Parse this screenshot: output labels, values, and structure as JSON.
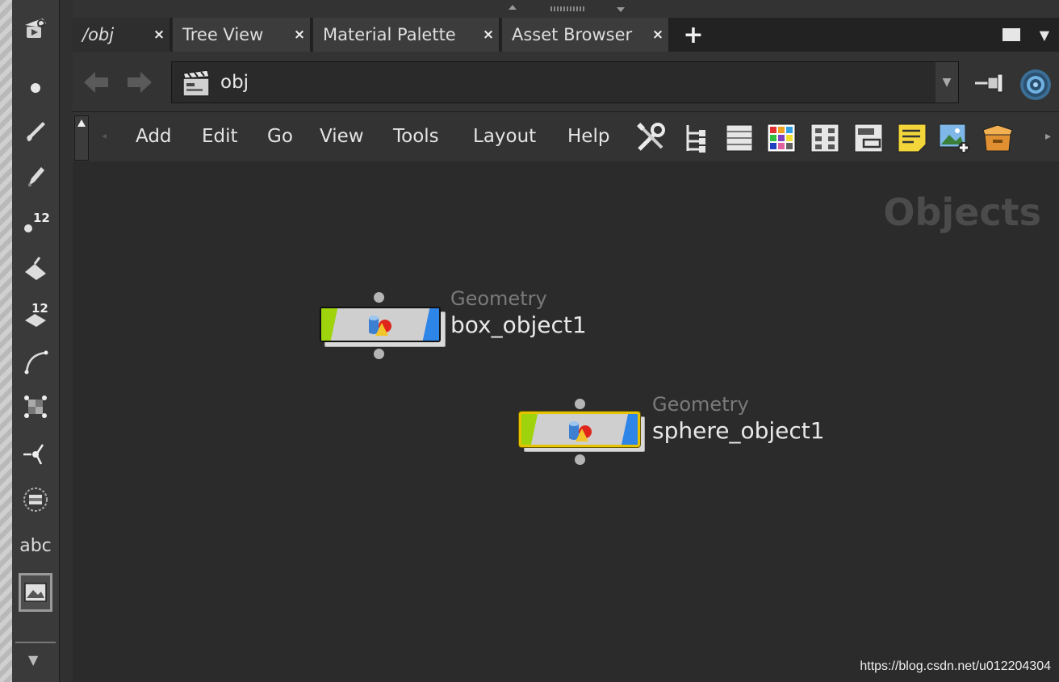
{
  "tabs": [
    {
      "label": "/obj",
      "close": "×",
      "active": true
    },
    {
      "label": "Tree View",
      "close": "×",
      "active": false
    },
    {
      "label": "Material Palette",
      "close": "×",
      "active": false
    },
    {
      "label": "Asset Browser",
      "close": "×",
      "active": false
    }
  ],
  "tab_add": "+",
  "path": {
    "value": "obj",
    "icon": "objects-network-icon"
  },
  "menu": [
    "Add",
    "Edit",
    "Go",
    "View",
    "Tools",
    "Layout",
    "Help"
  ],
  "toolbar_icons": [
    "wrench-tools-icon",
    "tree-view-icon",
    "list-view-icon",
    "color-palette-icon",
    "grid-layout-icon",
    "network-box-icon",
    "sticky-note-icon",
    "add-image-icon",
    "subnet-box-icon"
  ],
  "left_toolbar": {
    "items": [
      "view-tool-icon",
      "point-tool-icon",
      "brush-tool-icon",
      "pen-tool-icon",
      "number-tool-icon",
      "paint-bucket-icon",
      "number-flag-icon",
      "curve-tool-icon",
      "transform-handles-icon",
      "pivot-tool-icon",
      "circle-tool-icon",
      "text-tool-icon",
      "image-tool-icon"
    ],
    "text_tool_label": "abc"
  },
  "canvas": {
    "context_label": "Objects",
    "nodes": [
      {
        "type": "Geometry",
        "name": "box_object1",
        "selected": false
      },
      {
        "type": "Geometry",
        "name": "sphere_object1",
        "selected": true
      }
    ]
  },
  "watermark": "https://blog.csdn.net/u012204304",
  "colors": {
    "node_flag_left": "#9fd40d",
    "node_flag_right": "#2e85e8",
    "selection": "#e6c300",
    "background": "#2b2b2b"
  }
}
